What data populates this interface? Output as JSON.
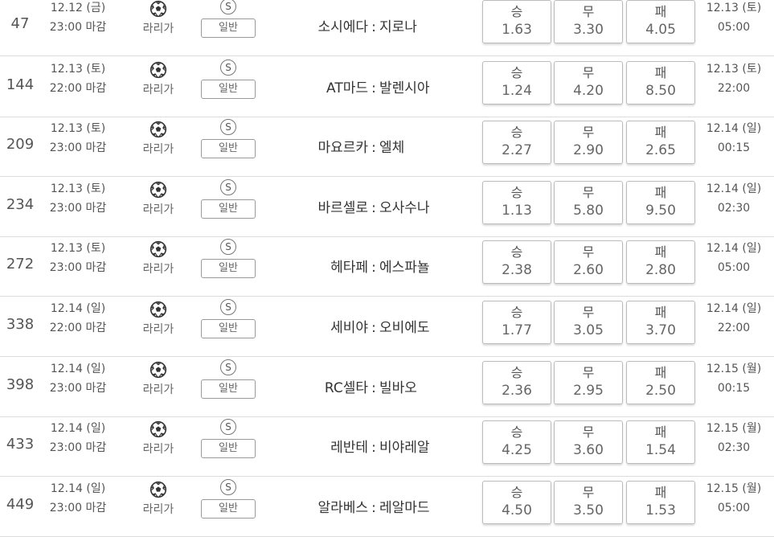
{
  "labels": {
    "win": "승",
    "draw": "무",
    "lose": "패",
    "game_type_icon": "S",
    "game_type": "일반",
    "separator": ":"
  },
  "icons": {
    "league": "soccer-ball-icon"
  },
  "colors": {
    "text": "#555555",
    "border": "#bbbbbb",
    "divider": "#dcdcdc"
  },
  "rows": [
    {
      "number": "47",
      "date": "12.12 (금)",
      "close": "23:00 마감",
      "league": "라리가",
      "home": "소시에다",
      "away": "지로나",
      "win": "1.63",
      "draw": "3.30",
      "lose": "4.05",
      "kickoff_date": "12.13 (토)",
      "kickoff_time": "05:00"
    },
    {
      "number": "144",
      "date": "12.13 (토)",
      "close": "22:00 마감",
      "league": "라리가",
      "home": "AT마드",
      "away": "발렌시아",
      "win": "1.24",
      "draw": "4.20",
      "lose": "8.50",
      "kickoff_date": "12.13 (토)",
      "kickoff_time": "22:00"
    },
    {
      "number": "209",
      "date": "12.13 (토)",
      "close": "23:00 마감",
      "league": "라리가",
      "home": "마요르카",
      "away": "엘체",
      "win": "2.27",
      "draw": "2.90",
      "lose": "2.65",
      "kickoff_date": "12.14 (일)",
      "kickoff_time": "00:15"
    },
    {
      "number": "234",
      "date": "12.13 (토)",
      "close": "23:00 마감",
      "league": "라리가",
      "home": "바르셀로",
      "away": "오사수나",
      "win": "1.13",
      "draw": "5.80",
      "lose": "9.50",
      "kickoff_date": "12.14 (일)",
      "kickoff_time": "02:30"
    },
    {
      "number": "272",
      "date": "12.13 (토)",
      "close": "23:00 마감",
      "league": "라리가",
      "home": "헤타페",
      "away": "에스파뇰",
      "win": "2.38",
      "draw": "2.60",
      "lose": "2.80",
      "kickoff_date": "12.14 (일)",
      "kickoff_time": "05:00"
    },
    {
      "number": "338",
      "date": "12.14 (일)",
      "close": "22:00 마감",
      "league": "라리가",
      "home": "세비야",
      "away": "오비에도",
      "win": "1.77",
      "draw": "3.05",
      "lose": "3.70",
      "kickoff_date": "12.14 (일)",
      "kickoff_time": "22:00"
    },
    {
      "number": "398",
      "date": "12.14 (일)",
      "close": "23:00 마감",
      "league": "라리가",
      "home": "RC셀타",
      "away": "빌바오",
      "win": "2.36",
      "draw": "2.95",
      "lose": "2.50",
      "kickoff_date": "12.15 (월)",
      "kickoff_time": "00:15"
    },
    {
      "number": "433",
      "date": "12.14 (일)",
      "close": "23:00 마감",
      "league": "라리가",
      "home": "레반테",
      "away": "비야레알",
      "win": "4.25",
      "draw": "3.60",
      "lose": "1.54",
      "kickoff_date": "12.15 (월)",
      "kickoff_time": "02:30"
    },
    {
      "number": "449",
      "date": "12.14 (일)",
      "close": "23:00 마감",
      "league": "라리가",
      "home": "알라베스",
      "away": "레알마드",
      "win": "4.50",
      "draw": "3.50",
      "lose": "1.53",
      "kickoff_date": "12.15 (월)",
      "kickoff_time": "05:00"
    }
  ]
}
